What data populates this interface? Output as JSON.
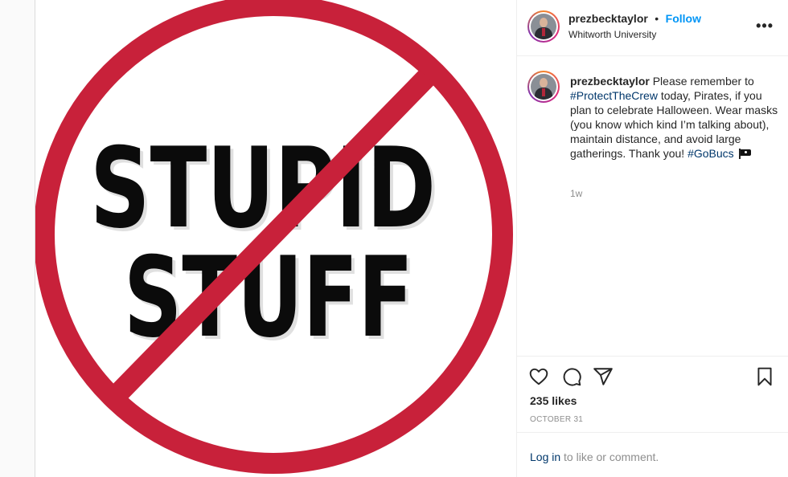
{
  "post": {
    "image_text": {
      "line1": "STUPID",
      "line2": "STUFF"
    },
    "colors": {
      "ring": "#c8213a",
      "text": "#0b0b0b",
      "background": "#ffffff"
    }
  },
  "header": {
    "username": "prezbecktaylor",
    "separator": "•",
    "follow_label": "Follow",
    "location": "Whitworth University",
    "more_icon": "more-horizontal-icon",
    "more_label": "•••"
  },
  "caption": {
    "username": "prezbecktaylor",
    "text_1": " Please remember to ",
    "hashtag_1": "#ProtectTheCrew",
    "text_2": " today, Pirates, if you plan to celebrate Halloween. Wear masks (you know which kind I’m talking about), maintain distance, and avoid large gatherings. Thank you! ",
    "hashtag_2": "#GoBucs",
    "emoji": "pirate-flag-icon",
    "time_ago": "1w"
  },
  "actions": {
    "like_icon": "heart-icon",
    "comment_icon": "comment-icon",
    "share_icon": "share-icon",
    "save_icon": "bookmark-icon"
  },
  "likes": {
    "count": "235",
    "suffix": " likes"
  },
  "date": "OCTOBER 31",
  "login": {
    "link": "Log in",
    "rest": " to like or comment."
  }
}
